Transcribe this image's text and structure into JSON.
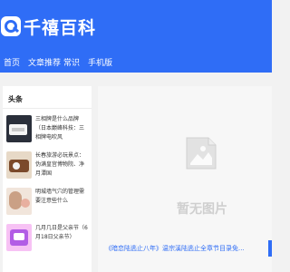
{
  "site": {
    "name": "千禧百科"
  },
  "nav": {
    "items": [
      "首页",
      "文章推荐",
      "常识",
      "手机版"
    ]
  },
  "sidebar": {
    "title": "头条",
    "news": [
      {
        "title": "三相牌是什么品牌（日本巅峰科技：三相牌电吹风"
      },
      {
        "title": "长春旅游必玩景点：伪满皇宫博物院、净月潭国"
      },
      {
        "title": "明城墙气穴的管理需要注意些什么"
      },
      {
        "title": "几月几日是父亲节（6月18日父亲节）"
      }
    ]
  },
  "main": {
    "placeholder_text": "暂无图片",
    "caption": "《暗恋陆逃止八年》温宗溪陆逃止全章节目录免..."
  },
  "colors": {
    "accent": "#2f6df6"
  }
}
